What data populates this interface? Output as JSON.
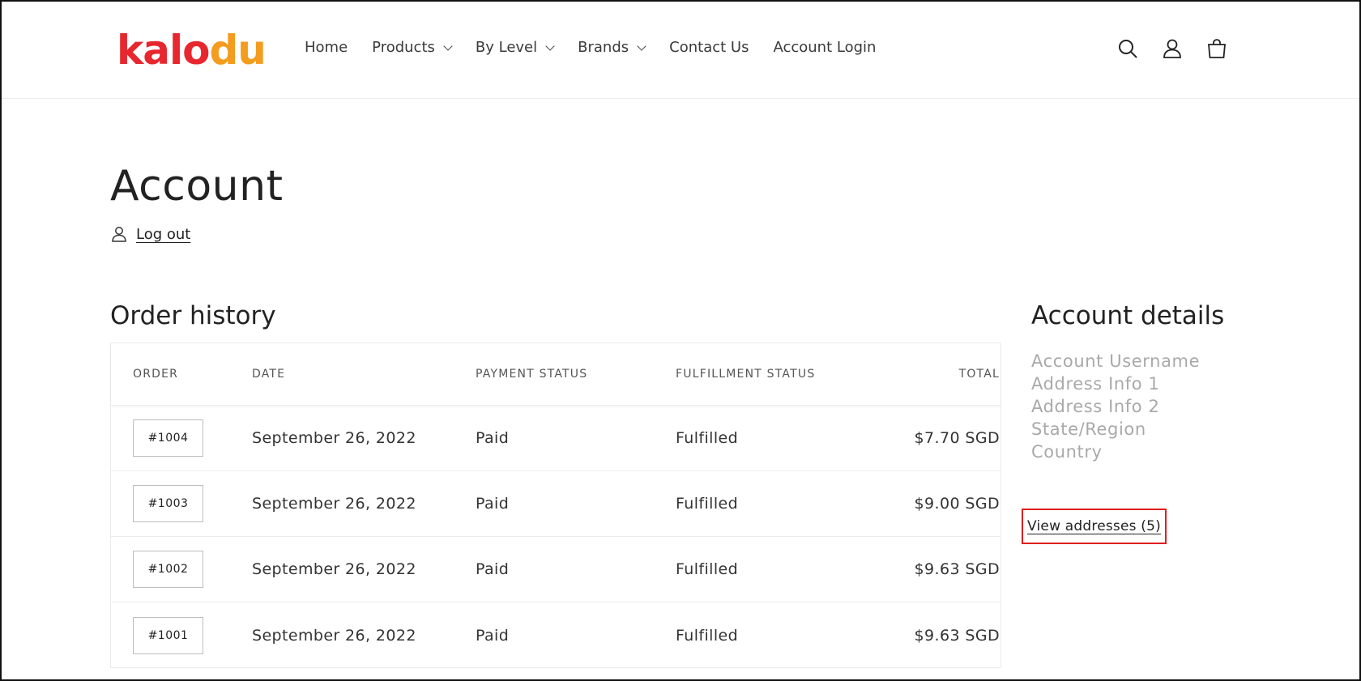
{
  "header": {
    "logo": {
      "part1": "kalo",
      "part2": "du",
      "color1": "#e8262e",
      "color2": "#f39c1e"
    },
    "nav": [
      {
        "label": "Home",
        "dropdown": false
      },
      {
        "label": "Products",
        "dropdown": true
      },
      {
        "label": "By Level",
        "dropdown": true
      },
      {
        "label": "Brands",
        "dropdown": true
      },
      {
        "label": "Contact Us",
        "dropdown": false
      },
      {
        "label": "Account Login",
        "dropdown": false
      }
    ],
    "icons": [
      "search-icon",
      "account-icon",
      "cart-icon"
    ]
  },
  "main": {
    "title": "Account",
    "logout_label": "Log out"
  },
  "order_history": {
    "title": "Order history",
    "columns": [
      "ORDER",
      "DATE",
      "PAYMENT STATUS",
      "FULFILLMENT STATUS",
      "TOTAL"
    ],
    "rows": [
      {
        "order": "#1004",
        "date": "September 26, 2022",
        "payment": "Paid",
        "fulfillment": "Fulfilled",
        "total": "$7.70 SGD"
      },
      {
        "order": "#1003",
        "date": "September 26, 2022",
        "payment": "Paid",
        "fulfillment": "Fulfilled",
        "total": "$9.00 SGD"
      },
      {
        "order": "#1002",
        "date": "September 26, 2022",
        "payment": "Paid",
        "fulfillment": "Fulfilled",
        "total": "$9.63 SGD"
      },
      {
        "order": "#1001",
        "date": "September 26, 2022",
        "payment": "Paid",
        "fulfillment": "Fulfilled",
        "total": "$9.63 SGD"
      }
    ]
  },
  "account_details": {
    "title": "Account details",
    "lines": [
      "Account Username",
      "Address Info 1",
      "Address Info 2",
      "State/Region",
      "Country"
    ],
    "view_addresses_label": "View addresses (5)",
    "highlight_color": "#e01e1e"
  }
}
